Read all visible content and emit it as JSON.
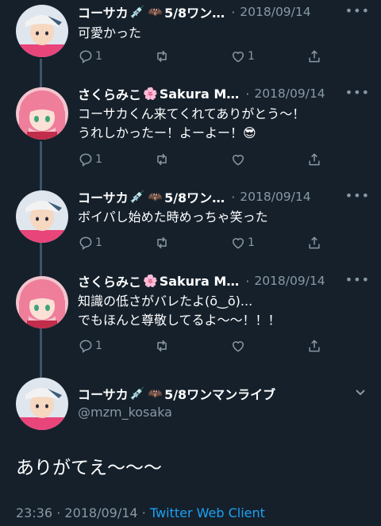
{
  "tweets": [
    {
      "name": "コーサカ",
      "name_suffix": "5/8ワン…",
      "emoji1": "💉",
      "emoji2": "🦇",
      "date": "2018/09/14",
      "text_lines": [
        "可愛かった"
      ],
      "replies": "1",
      "retweets": "",
      "likes": "1"
    },
    {
      "name": "さくらみこ",
      "name_suffix": "Sakura M…",
      "emoji1": "🌸",
      "emoji2": "",
      "date": "2018/09/14",
      "text_lines": [
        "コーサカくん来てくれてありがとう〜！",
        "うれしかったー！よーよー！😎"
      ],
      "replies": "1",
      "retweets": "",
      "likes": ""
    },
    {
      "name": "コーサカ",
      "name_suffix": "5/8ワン…",
      "emoji1": "💉",
      "emoji2": "🦇",
      "date": "2018/09/14",
      "text_lines": [
        "ボイパし始めた時めっちゃ笑った"
      ],
      "replies": "1",
      "retweets": "",
      "likes": "1"
    },
    {
      "name": "さくらみこ",
      "name_suffix": "Sakura M…",
      "emoji1": "🌸",
      "emoji2": "",
      "date": "2018/09/14",
      "text_lines": [
        "知識の低さがバレたよ(ō‿ō)...",
        "でもほんと尊敬してるよ〜〜！！！"
      ],
      "replies": "1",
      "retweets": "",
      "likes": ""
    }
  ],
  "main_tweet": {
    "name": "コーサカ",
    "emoji1": "💉",
    "emoji2": "🦇",
    "name_suffix": "5/8ワンマンライブ",
    "handle": "@mzm_kosaka",
    "text": "ありがてえ〜〜〜",
    "time": "23:36",
    "date": "2018/09/14",
    "client": "Twitter Web Client"
  },
  "ui": {
    "separator": "·",
    "more": "•••"
  },
  "colors": {
    "background": "#15202b",
    "secondary_text": "#8899a6",
    "link": "#1da1f2",
    "thread_line": "#3d5466"
  }
}
